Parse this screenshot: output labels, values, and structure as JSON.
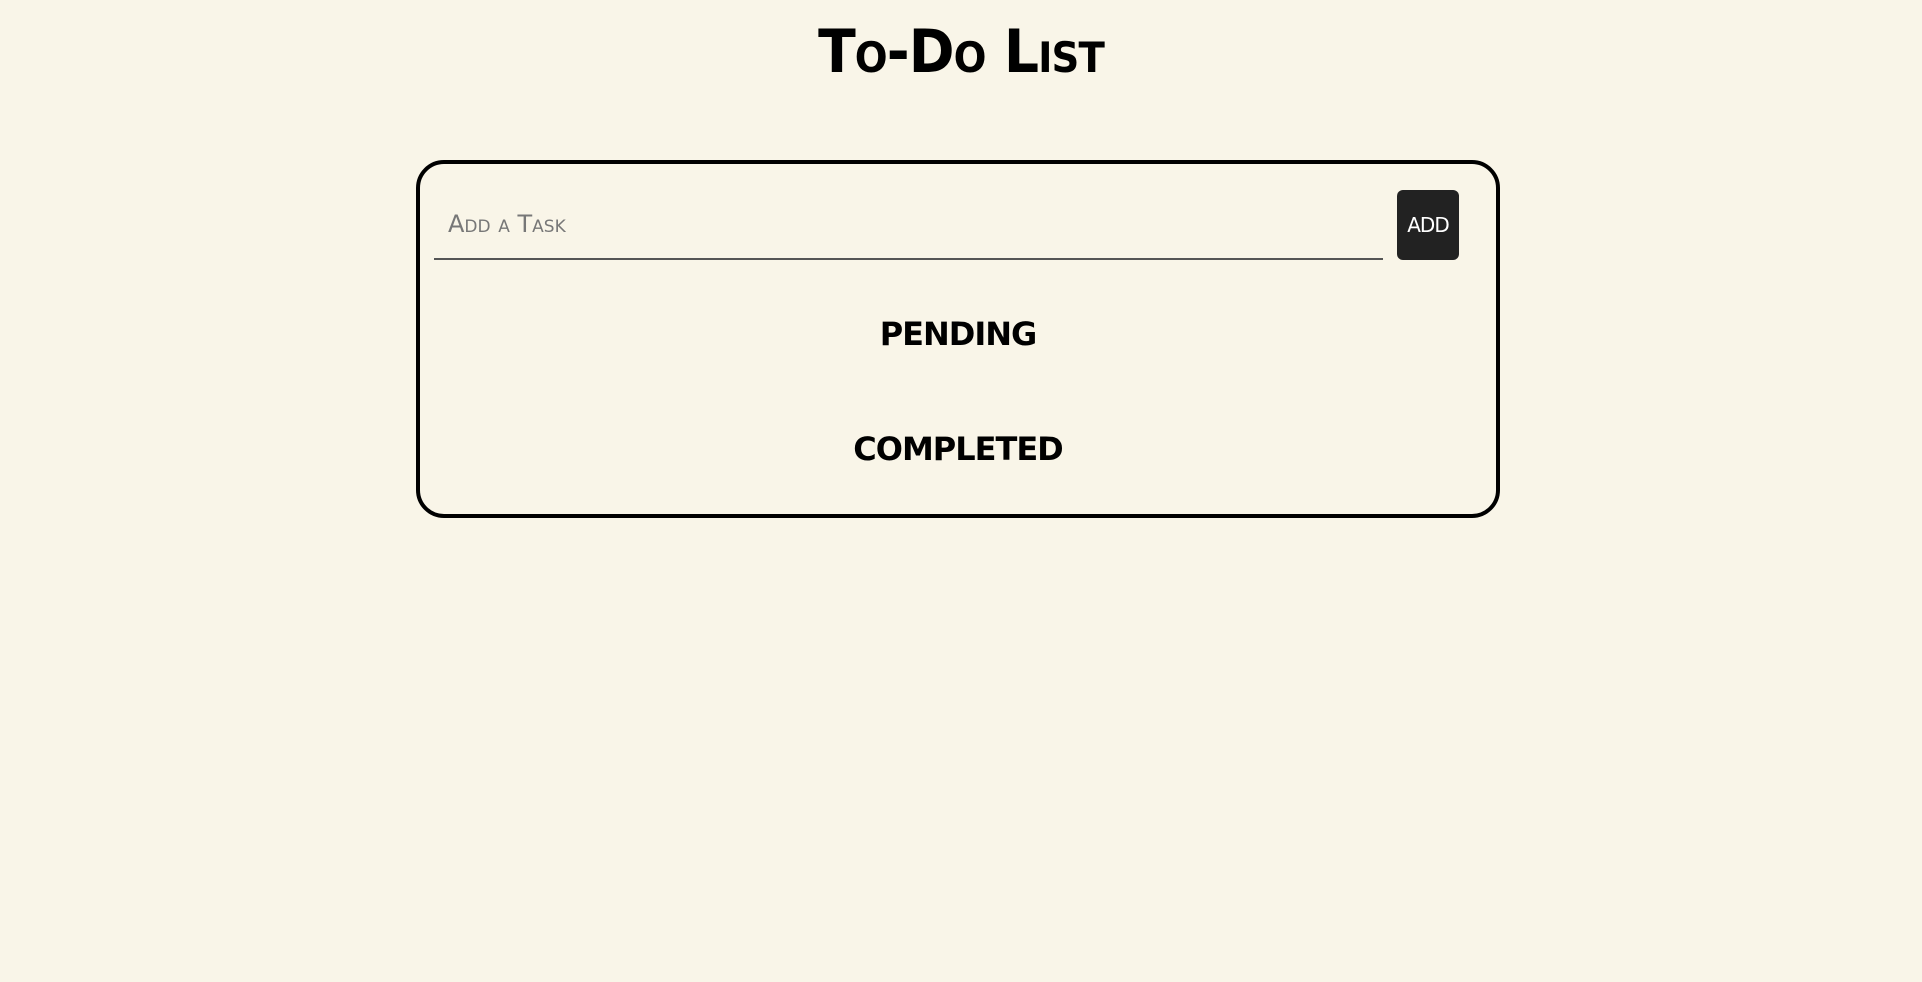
{
  "header": {
    "title": "To-Do List"
  },
  "task_input": {
    "placeholder": "Add a Task",
    "value": ""
  },
  "add_button": {
    "label": "ADD"
  },
  "sections": {
    "pending": {
      "heading": "PENDING",
      "tasks": []
    },
    "completed": {
      "heading": "COMPLETED",
      "tasks": []
    }
  },
  "colors": {
    "background": "#f9f5e8",
    "text": "#000000",
    "button_background": "#222222",
    "button_text": "#ffffff"
  }
}
